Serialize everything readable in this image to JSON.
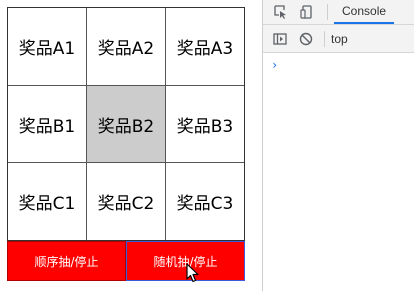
{
  "grid": {
    "rows": [
      [
        "奖品A1",
        "奖品A2",
        "奖品A3"
      ],
      [
        "奖品B1",
        "奖品B2",
        "奖品B3"
      ],
      [
        "奖品C1",
        "奖品C2",
        "奖品C3"
      ]
    ],
    "active_cell": "奖品B2"
  },
  "buttons": {
    "sequential_label": "顺序抽/停止",
    "random_label": "随机抽/停止"
  },
  "devtools": {
    "console_tab": "Console",
    "context": "top",
    "prompt": "›"
  },
  "colors": {
    "button_bg": "#ff0000",
    "active_cell_bg": "#cccccc",
    "accent": "#1a73e8"
  }
}
